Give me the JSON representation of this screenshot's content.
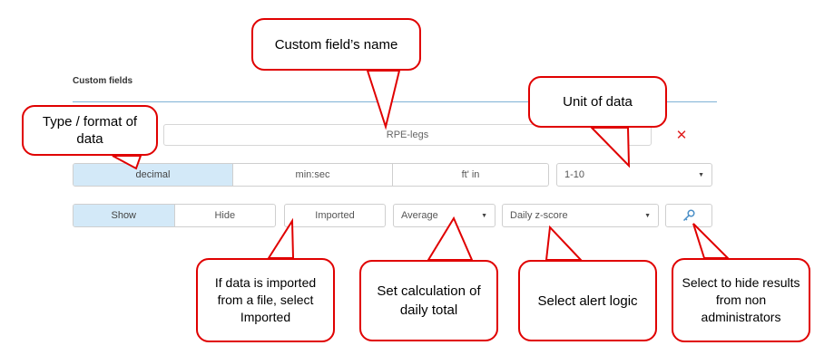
{
  "section": {
    "title": "Custom fields"
  },
  "field": {
    "name_value": "RPE-legs",
    "remove_glyph": "✕",
    "remove_icon": "close-icon"
  },
  "format_options": [
    {
      "label": "decimal",
      "active": true
    },
    {
      "label": "min:sec",
      "active": false
    },
    {
      "label": "ft' in",
      "active": false
    }
  ],
  "unit_select": {
    "value": "1-10"
  },
  "visibility_options": [
    {
      "label": "Show",
      "active": true
    },
    {
      "label": "Hide",
      "active": false
    }
  ],
  "imported_button": {
    "label": "Imported"
  },
  "calc_select": {
    "value": "Average"
  },
  "alert_select": {
    "value": "Daily z-score"
  },
  "key_button": {
    "icon": "key-icon"
  },
  "callouts": {
    "name": "Custom field’s name",
    "type": "Type / format of data",
    "unit": "Unit of data",
    "imported": "If data is imported from a file, select Imported",
    "calculation": "Set calculation of daily total",
    "alert": "Select alert logic",
    "hide": "Select to hide results from non administrators"
  },
  "colors": {
    "accent_active": "#d3e9f8",
    "divider": "#7fb2d6",
    "callout_border": "#e00000",
    "remove": "#e02020",
    "key_icon": "#4a8fc7"
  }
}
